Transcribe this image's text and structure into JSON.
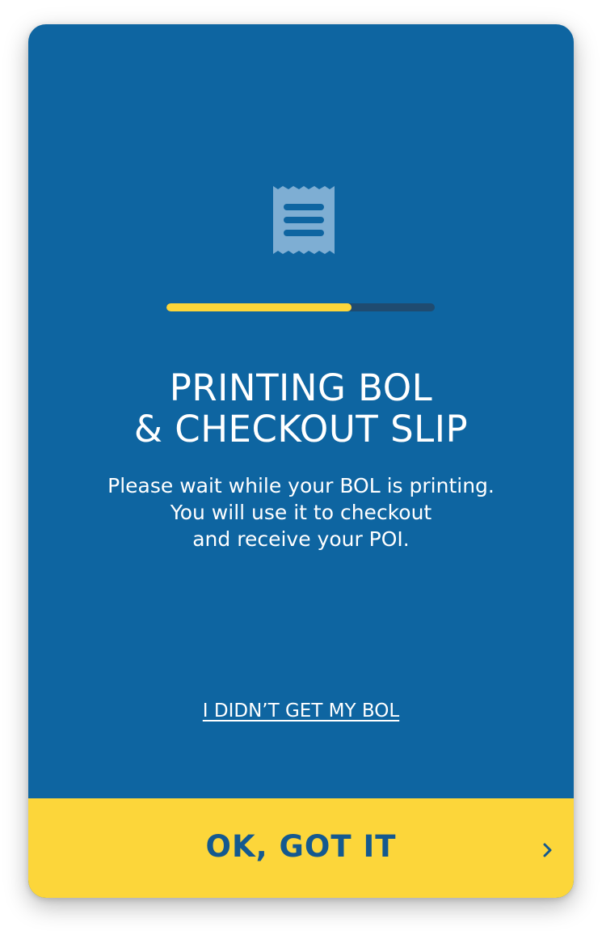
{
  "dialog": {
    "icon": "receipt-icon",
    "progress": 0.69,
    "title_line1": "PRINTING BOL",
    "title_line2": "& CHECKOUT SLIP",
    "description_line1": "Please wait while your BOL is printing.",
    "description_line2": "You will use it to checkout",
    "description_line3": "and receive your POI.",
    "link_label": "I DIDN’T GET MY BOL",
    "ok_button_label": "OK, GOT IT",
    "ok_button_icon": "chevron-right-icon"
  },
  "colors": {
    "card_background": "#0e65a1",
    "accent_yellow": "#fcd63a",
    "progress_track": "#1f4b70",
    "button_text": "#14598f",
    "icon_color": "#7eaed3"
  }
}
